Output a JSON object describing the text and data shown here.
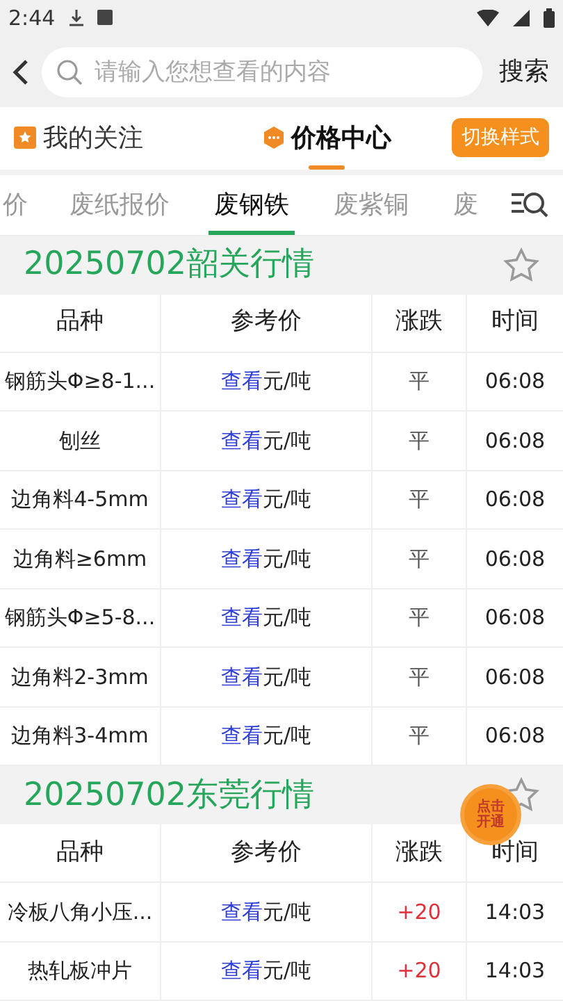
{
  "status_bar": {
    "time": "2:44"
  },
  "search": {
    "placeholder": "请输入您想查看的内容",
    "button": "搜索"
  },
  "top_tabs": [
    {
      "label": "我的关注",
      "selected": false,
      "kind": "bookmark"
    },
    {
      "label": "价格中心",
      "selected": true,
      "kind": "hexagon"
    }
  ],
  "switch_button": "切换样式",
  "category_tabs": [
    {
      "label": "价",
      "selected": false
    },
    {
      "label": "废纸报价",
      "selected": false
    },
    {
      "label": "废钢铁",
      "selected": true
    },
    {
      "label": "废紫铜",
      "selected": false
    },
    {
      "label": "废",
      "selected": false
    }
  ],
  "sections": [
    {
      "title": "20250702韶关行情",
      "columns": [
        "品种",
        "参考价",
        "涨跌",
        "时间"
      ],
      "rows": [
        {
          "name": "钢筋头Φ≥8-1...",
          "link": "查看",
          "unit": "元/吨",
          "change": "平",
          "kind": "flat",
          "time": "06:08"
        },
        {
          "name": "刨丝",
          "link": "查看",
          "unit": "元/吨",
          "change": "平",
          "kind": "flat",
          "time": "06:08"
        },
        {
          "name": "边角料4-5mm",
          "link": "查看",
          "unit": "元/吨",
          "change": "平",
          "kind": "flat",
          "time": "06:08"
        },
        {
          "name": "边角料≥6mm",
          "link": "查看",
          "unit": "元/吨",
          "change": "平",
          "kind": "flat",
          "time": "06:08"
        },
        {
          "name": "钢筋头Φ≥5-8...",
          "link": "查看",
          "unit": "元/吨",
          "change": "平",
          "kind": "flat",
          "time": "06:08"
        },
        {
          "name": "边角料2-3mm",
          "link": "查看",
          "unit": "元/吨",
          "change": "平",
          "kind": "flat",
          "time": "06:08"
        },
        {
          "name": "边角料3-4mm",
          "link": "查看",
          "unit": "元/吨",
          "change": "平",
          "kind": "flat",
          "time": "06:08"
        }
      ]
    },
    {
      "title": "20250702东莞行情",
      "columns": [
        "品种",
        "参考价",
        "涨跌",
        "时间"
      ],
      "rows": [
        {
          "name": "冷板八角小压...",
          "link": "查看",
          "unit": "元/吨",
          "change": "+20",
          "kind": "up",
          "time": "14:03"
        },
        {
          "name": "热轧板冲片",
          "link": "查看",
          "unit": "元/吨",
          "change": "+20",
          "kind": "up",
          "time": "14:03"
        }
      ]
    }
  ],
  "promo_badge": {
    "line1": "点击",
    "line2": "开通"
  }
}
